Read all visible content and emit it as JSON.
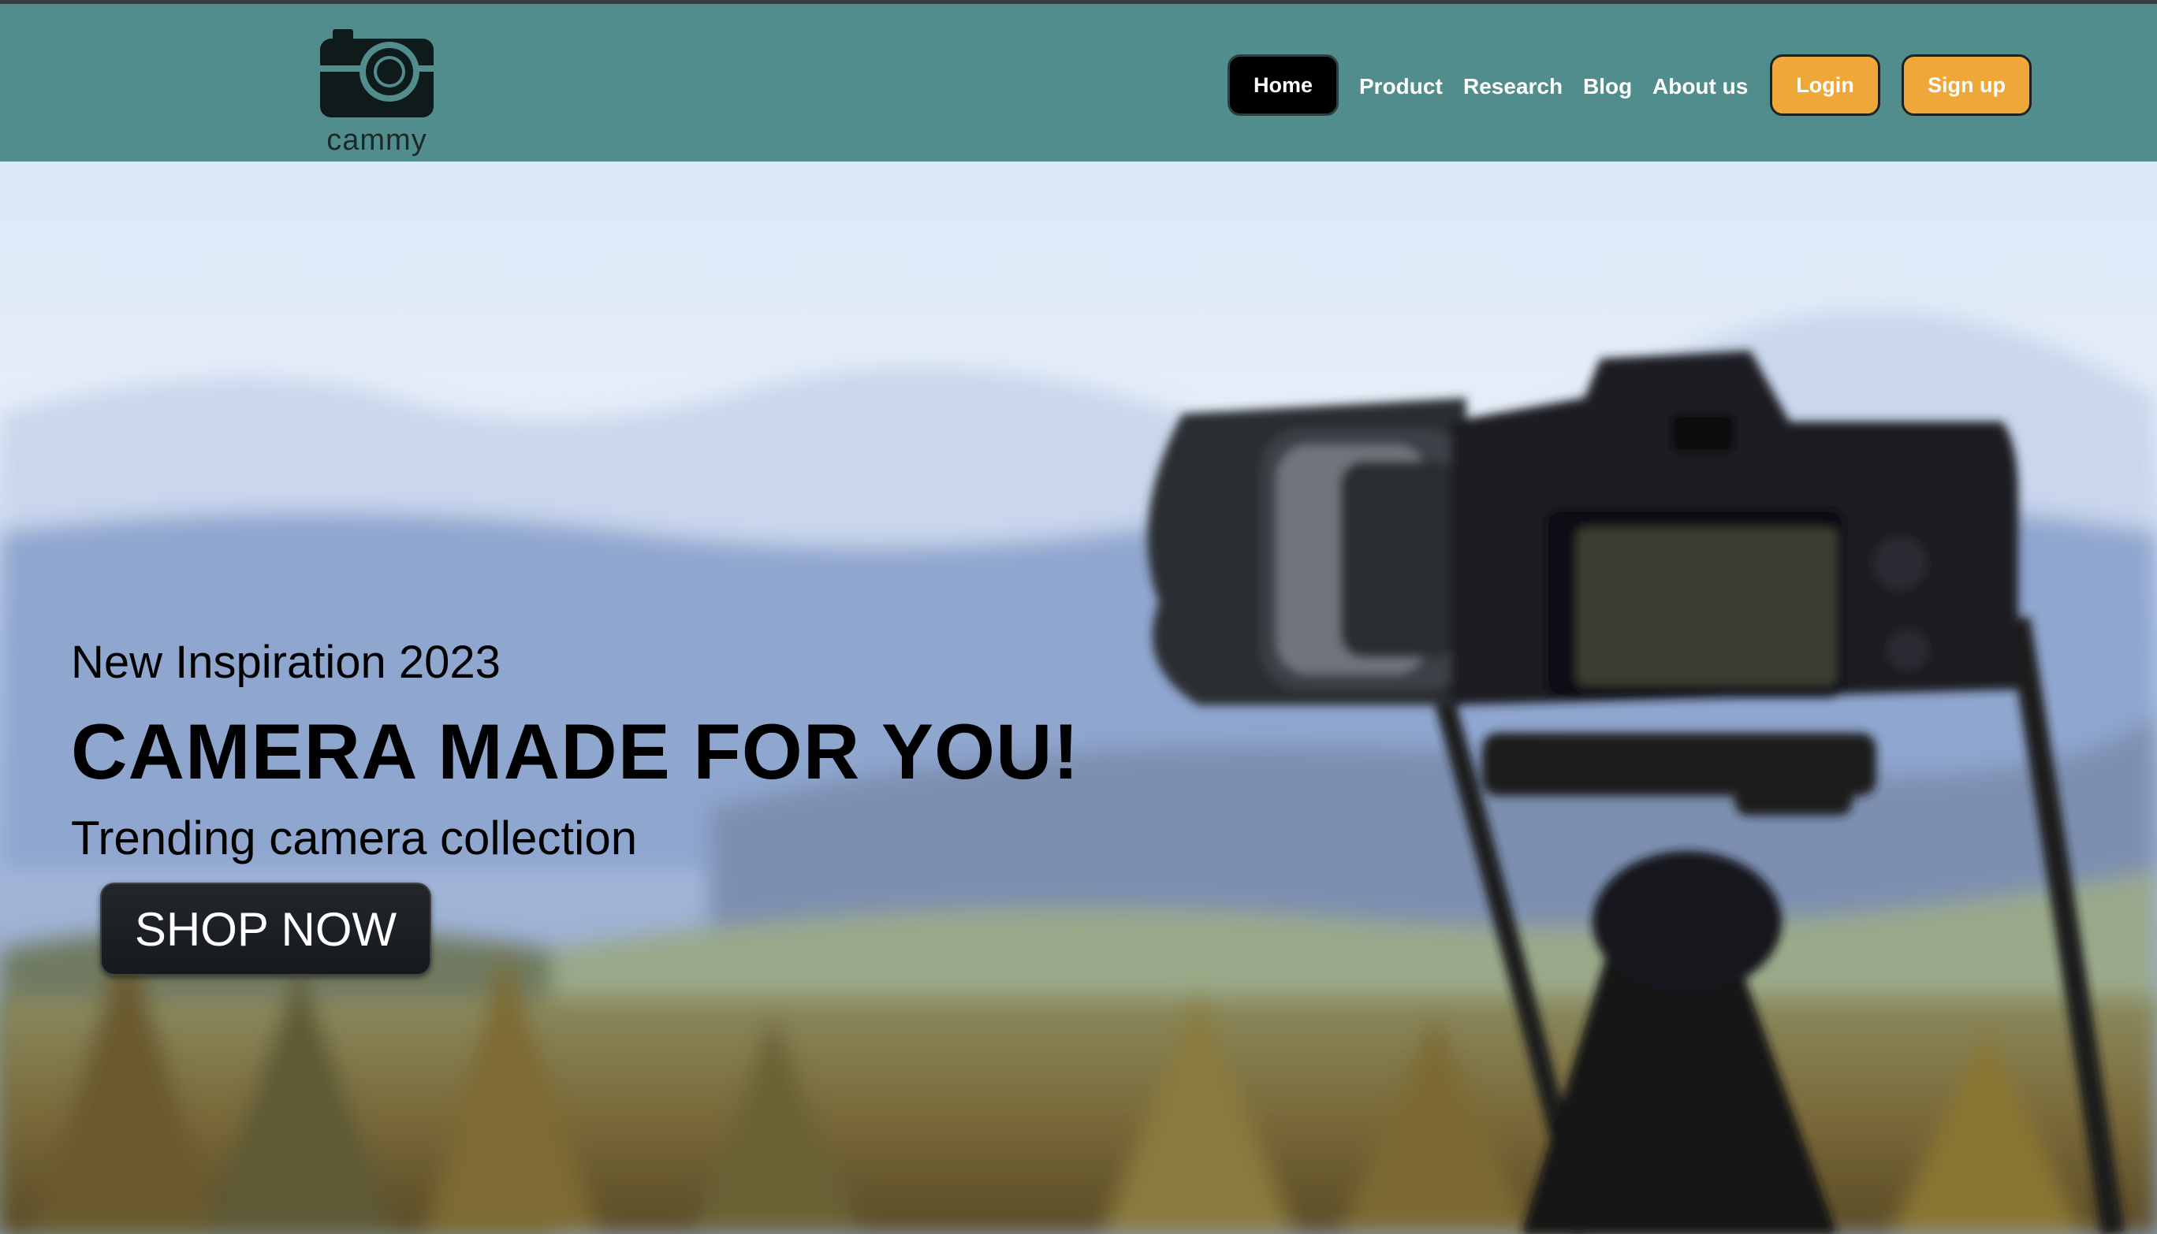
{
  "brand": {
    "logo_text": "cammy",
    "logo_icon": "camera-icon"
  },
  "nav": {
    "home": "Home",
    "product": "Product",
    "research": "Research",
    "blog": "Blog",
    "about": "About us",
    "login": "Login",
    "signup": "Sign up"
  },
  "hero": {
    "overline": "New Inspiration 2023",
    "title": "CAMERA MADE FOR YOU!",
    "subtitle": "Trending camera collection",
    "cta": "SHOP NOW"
  },
  "colors": {
    "header_bg": "#528d8d",
    "accent_orange": "#f0a73a",
    "home_button": "#000000",
    "cta_bg": "#1c1f23"
  }
}
